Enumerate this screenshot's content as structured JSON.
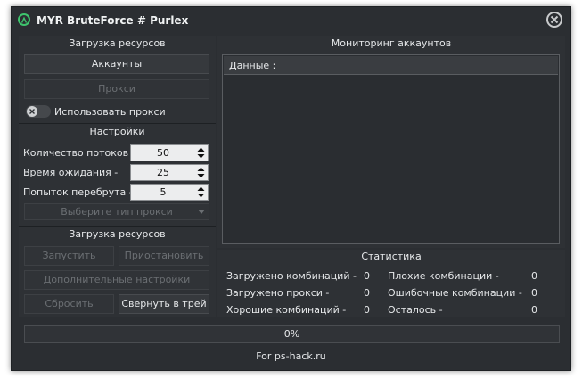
{
  "window": {
    "title": "MYR BruteForce # Purlex"
  },
  "resources": {
    "title": "Загрузка ресурсов",
    "accounts_button": "Аккаунты",
    "proxy_button": "Прокси",
    "use_proxy_label": "Использовать прокси",
    "use_proxy_enabled": false
  },
  "settings": {
    "title": "Настройки",
    "threads_label": "Количество потоков -",
    "threads_value": "50",
    "timeout_label": "Время ожидания -",
    "timeout_value": "25",
    "retries_label": "Попыток перебрута -",
    "retries_value": "5",
    "proxy_type_placeholder": "Выберите тип прокси"
  },
  "actions": {
    "title": "Загрузка ресурсов",
    "start": "Запустить",
    "pause": "Приостановить",
    "advanced": "Дополнительные настройки",
    "reset": "Сбросить",
    "minimize_tray": "Свернуть в трей"
  },
  "monitoring": {
    "title": "Мониторинг аккаунтов",
    "column_header": "Данные :"
  },
  "stats": {
    "title": "Статистика",
    "loaded_combos_label": "Загружено комбинаций -",
    "loaded_combos_value": "0",
    "loaded_proxies_label": "Загружено прокси -",
    "loaded_proxies_value": "0",
    "good_combos_label": "Хорошие комбинаций -",
    "good_combos_value": "0",
    "bad_combos_label": "Плохие комбинации -",
    "bad_combos_value": "0",
    "error_combos_label": "Ошибочные комбинации -",
    "error_combos_value": "0",
    "remaining_label": "Осталось -",
    "remaining_value": "0"
  },
  "progress": {
    "percent": 0,
    "label": "0%"
  },
  "footer": {
    "text": "For ps-hack.ru"
  },
  "colors": {
    "accent": "#3ec46d",
    "background": "#2b2e32"
  }
}
